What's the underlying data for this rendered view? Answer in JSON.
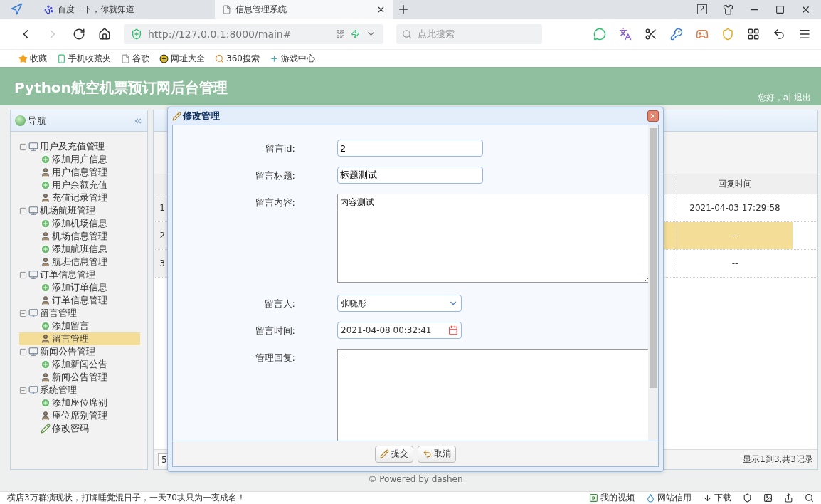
{
  "browser": {
    "tabs": [
      {
        "title": "百度一下，你就知道",
        "selected": false
      },
      {
        "title": "信息管理系统",
        "selected": true
      }
    ],
    "tab_count": "2",
    "url": "http://127.0.0.1:8000/main#",
    "search_placeholder": "点此搜索",
    "bookmarks": [
      "收藏",
      "手机收藏夹",
      "谷歌",
      "网址大全",
      "360搜索",
      "游戏中心"
    ]
  },
  "header": {
    "title": "Python航空机票预订网后台管理",
    "user": "您好，a| 退出"
  },
  "nav": {
    "title": "导航",
    "groups": [
      {
        "label": "用户及充值管理",
        "expanded": true,
        "children": [
          {
            "label": "添加用户信息",
            "kind": "add",
            "selected": false
          },
          {
            "label": "用户信息管理",
            "kind": "manage",
            "selected": false
          },
          {
            "label": "用户余额充值",
            "kind": "add",
            "selected": false
          },
          {
            "label": "充值记录管理",
            "kind": "manage",
            "selected": false
          }
        ]
      },
      {
        "label": "机场航班管理",
        "expanded": true,
        "children": [
          {
            "label": "添加机场信息",
            "kind": "add",
            "selected": false
          },
          {
            "label": "机场信息管理",
            "kind": "manage",
            "selected": false
          },
          {
            "label": "添加航班信息",
            "kind": "add",
            "selected": false
          },
          {
            "label": "航班信息管理",
            "kind": "manage",
            "selected": false
          }
        ]
      },
      {
        "label": "订单信息管理",
        "expanded": true,
        "children": [
          {
            "label": "添加订单信息",
            "kind": "add",
            "selected": false
          },
          {
            "label": "订单信息管理",
            "kind": "manage",
            "selected": false
          }
        ]
      },
      {
        "label": "留言管理",
        "expanded": true,
        "children": [
          {
            "label": "添加留言",
            "kind": "add",
            "selected": false
          },
          {
            "label": "留言管理",
            "kind": "manage",
            "selected": true
          }
        ]
      },
      {
        "label": "新闻公告管理",
        "expanded": true,
        "children": [
          {
            "label": "添加新闻公告",
            "kind": "add",
            "selected": false
          },
          {
            "label": "新闻公告管理",
            "kind": "manage",
            "selected": false
          }
        ]
      },
      {
        "label": "系统管理",
        "expanded": true,
        "children": [
          {
            "label": "添加座位席别",
            "kind": "add",
            "selected": false
          },
          {
            "label": "座位席别管理",
            "kind": "manage",
            "selected": false
          },
          {
            "label": "修改密码",
            "kind": "edit",
            "selected": false
          }
        ]
      }
    ]
  },
  "grid": {
    "columns": [
      "回复时间"
    ],
    "rows": [
      {
        "number": "1",
        "reply_time": "2021-04-03 17:29:58",
        "selected": false
      },
      {
        "number": "2",
        "reply_time": "--",
        "selected": true
      },
      {
        "number": "3",
        "reply_time": "--",
        "selected": false
      }
    ],
    "page_size": "5",
    "summary": "显示1到3,共3记录"
  },
  "dialog": {
    "title": "修改管理",
    "fields": [
      {
        "label": "留言id:",
        "kind": "text",
        "value": "2"
      },
      {
        "label": "留言标题:",
        "kind": "text",
        "value": "标题测试"
      },
      {
        "label": "留言内容:",
        "kind": "textarea",
        "value": "内容测试"
      },
      {
        "label": "留言人:",
        "kind": "select",
        "value": "张晓彤"
      },
      {
        "label": "留言时间:",
        "kind": "date",
        "value": "2021-04-08 00:32:41"
      },
      {
        "label": "管理回复:",
        "kind": "textarea",
        "value": "--"
      }
    ],
    "buttons": [
      {
        "label": "提交",
        "kind": "submit"
      },
      {
        "label": "取消",
        "kind": "cancel"
      }
    ]
  },
  "footer": "© Powered by dashen",
  "status_bar": {
    "news": "横店3万群演现状，打牌睡觉混日子，一天70块只为一夜成名！",
    "items": [
      {
        "label": "我的视频",
        "kind": "video"
      },
      {
        "label": "网站信用",
        "kind": "credit"
      },
      {
        "label": "下载",
        "kind": "download"
      }
    ]
  }
}
